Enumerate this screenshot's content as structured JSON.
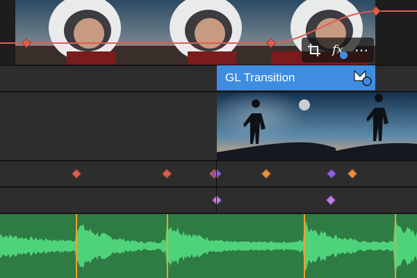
{
  "clip": {
    "title": "GL Transition"
  },
  "toolbar": {
    "fx_label": "fx",
    "more_glyph": "⋯"
  },
  "icons": {
    "crop": "crop-icon",
    "fx": "fx-icon",
    "more": "more-icon",
    "transition": "transition-icon"
  },
  "colors": {
    "background": "#232323",
    "track": "#2d2d2d",
    "clip_title": "#3f8de0",
    "audio": "#2f7b44",
    "waveform": "#4fd37a",
    "marker": "#f0a030",
    "curve": "#e05d4e",
    "kf_orange": "#ee8f3c",
    "kf_purple": "#8e5fe0",
    "kf_lilac": "#c57ee6"
  }
}
